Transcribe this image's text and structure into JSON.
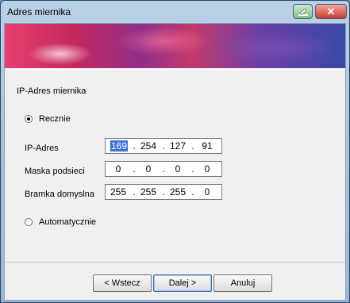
{
  "window": {
    "title": "Adres miernika"
  },
  "section": {
    "title": "IP-Adres miernika"
  },
  "mode": {
    "manual_label": "Recznie",
    "auto_label": "Automatycznie",
    "selected": "manual"
  },
  "fields": [
    {
      "label": "IP-Adres",
      "octets": [
        "169",
        "254",
        "127",
        "91"
      ]
    },
    {
      "label": "Maska podsieci",
      "octets": [
        "0",
        "0",
        "0",
        "0"
      ]
    },
    {
      "label": "Bramka domyslna",
      "octets": [
        "255",
        "255",
        "255",
        "0"
      ]
    }
  ],
  "buttons": {
    "back": "< Wstecz",
    "next": "Dalej >",
    "cancel": "Anuluj"
  },
  "colors": {
    "selection": "#3b6fd6",
    "close": "#c83c2c",
    "help": "#7fbf7f"
  },
  "icons": {
    "help": "help-icon",
    "close": "close-icon"
  }
}
